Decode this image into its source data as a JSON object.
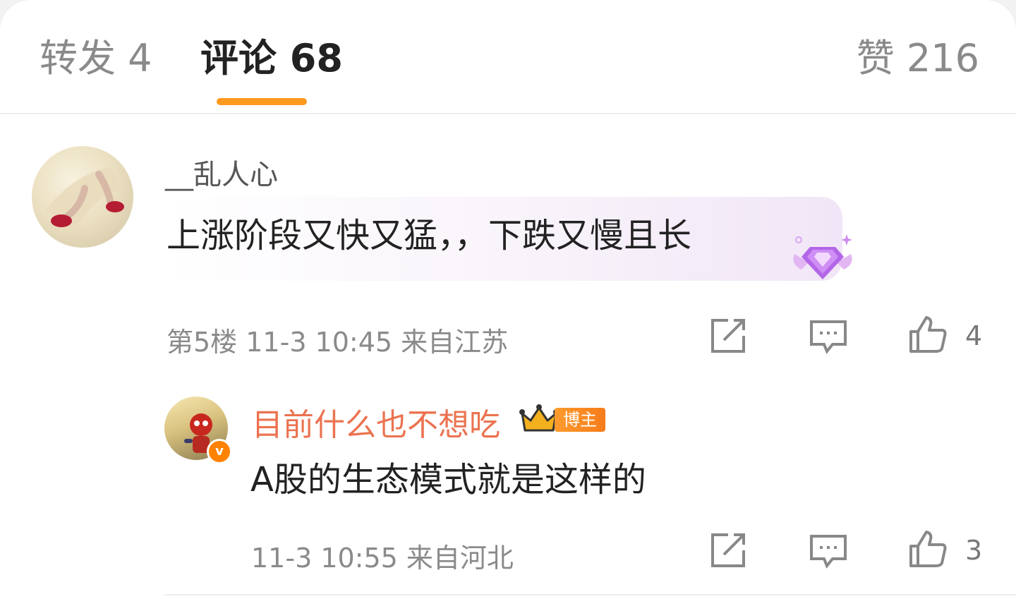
{
  "tabs": {
    "repost": "转发 4",
    "comment": "评论 68",
    "like": "赞 216"
  },
  "comment": {
    "username": "__乱人心",
    "text": "上涨阶段又快又猛，，下跌又慢且长",
    "meta": "第5楼 11-3 10:45 来自江苏",
    "like_count": "4"
  },
  "reply": {
    "username": "目前什么也不想吃",
    "badge": "博主",
    "text": "A股的生态模式就是这样的",
    "meta": "11-3 10:55 来自河北",
    "like_count": "3"
  },
  "colors": {
    "accent": "#ff9a1f",
    "author_name": "#eb7350",
    "verified": "#ff8200"
  },
  "icons": [
    "share-icon",
    "comment-icon",
    "like-icon",
    "crown-icon",
    "gem-badge-icon"
  ]
}
